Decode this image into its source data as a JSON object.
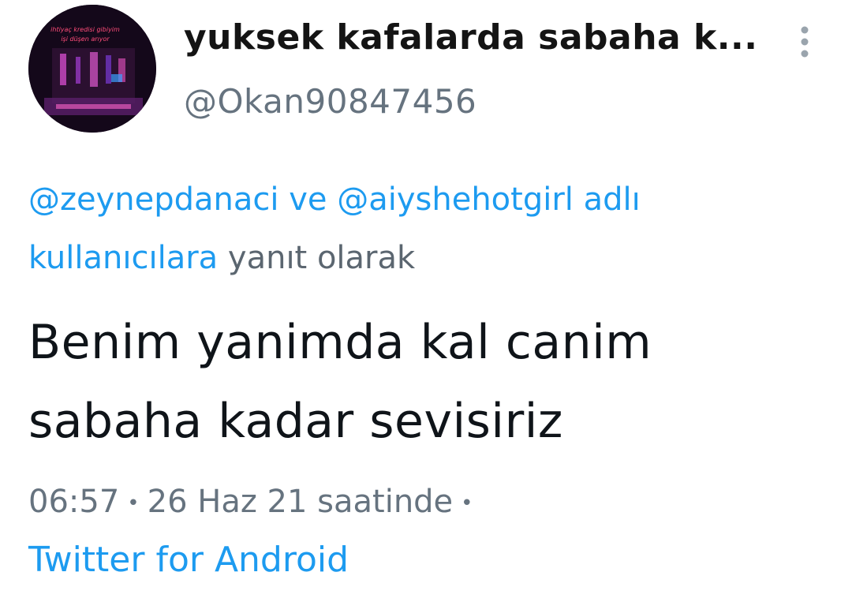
{
  "author": {
    "display_name": "yuksek kafalarda sabaha k...",
    "handle": "@Okan90847456",
    "avatar_text_line1": "ihtiyaç kredisi gibiyim",
    "avatar_text_line2": "işi düşen arıyor"
  },
  "reply_context": {
    "mention1": "@zeynepdanaci",
    "connector": " ve ",
    "mention2": "@aiyshehotgirl",
    "suffix_link_line1": " adlı",
    "suffix_link_line2": "kullanıcılara",
    "tail": " yanıt olarak"
  },
  "tweet": {
    "text_line1": "Benim yanimda kal canim",
    "text_line2": "sabaha kadar sevisiriz"
  },
  "meta": {
    "time": "06:57",
    "date": "26 Haz 21 saatinde",
    "separator": "•",
    "source": "Twitter for Android"
  },
  "icons": {
    "more": "more-vertical-icon"
  },
  "colors": {
    "link": "#1d9bf0",
    "secondary_text": "#66737f",
    "primary_text": "#0f1419",
    "background": "#ffffff"
  }
}
